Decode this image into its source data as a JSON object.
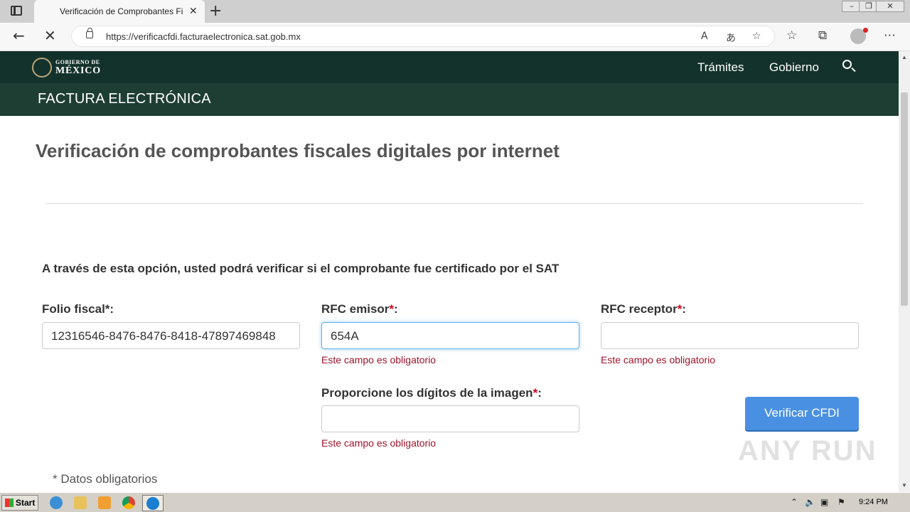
{
  "browser": {
    "tab_title": "Verificación de Comprobantes Fi",
    "tab_close": "✕",
    "new_tab": "+",
    "url": "https://verificacfdi.facturaelectronica.sat.gob.mx",
    "icons": [
      "back-icon",
      "stop-icon",
      "lock-icon",
      "read-aloud-icon",
      "translate-icon",
      "add-favorite-icon",
      "favorites-icon",
      "collections-icon",
      "profile-icon",
      "more-icon"
    ]
  },
  "site_header": {
    "logo_line1": "GOBIERNO DE",
    "logo_line2": "MÉXICO",
    "nav": [
      "Trámites",
      "Gobierno"
    ],
    "section_title": "FACTURA ELECTRÓNICA"
  },
  "main": {
    "title": "Verificación de comprobantes fiscales digitales por internet",
    "intro": "A través de esta opción, usted podrá verificar si el comprobante fue certificado por el SAT",
    "fields": {
      "folio": {
        "label": "Folio fiscal",
        "asterisk": "*",
        "colon": ":",
        "value": "12316546-8476-8476-8418-47897469848"
      },
      "rfc_emisor": {
        "label": "RFC emisor",
        "asterisk": "*",
        "colon": ":",
        "value": "654A",
        "error": "Este campo es obligatorio"
      },
      "rfc_receptor": {
        "label": "RFC receptor",
        "asterisk": "*",
        "colon": ":",
        "value": "",
        "error": "Este campo es obligatorio"
      },
      "captcha": {
        "label": "Proporcione los dígitos de la imagen",
        "asterisk": "*",
        "colon": ":",
        "value": "",
        "error": "Este campo es obligatorio"
      }
    },
    "submit_label": "Verificar CFDI",
    "required_note": "* Datos obligatorios"
  },
  "watermark": "ANY RUN",
  "taskbar": {
    "start_label": "Start",
    "clock": "9:24 PM"
  },
  "colors": {
    "gob_green": "#13322b",
    "section_green": "#1e3e34",
    "button_blue": "#4a90e2",
    "error_red": "#a0142b"
  }
}
